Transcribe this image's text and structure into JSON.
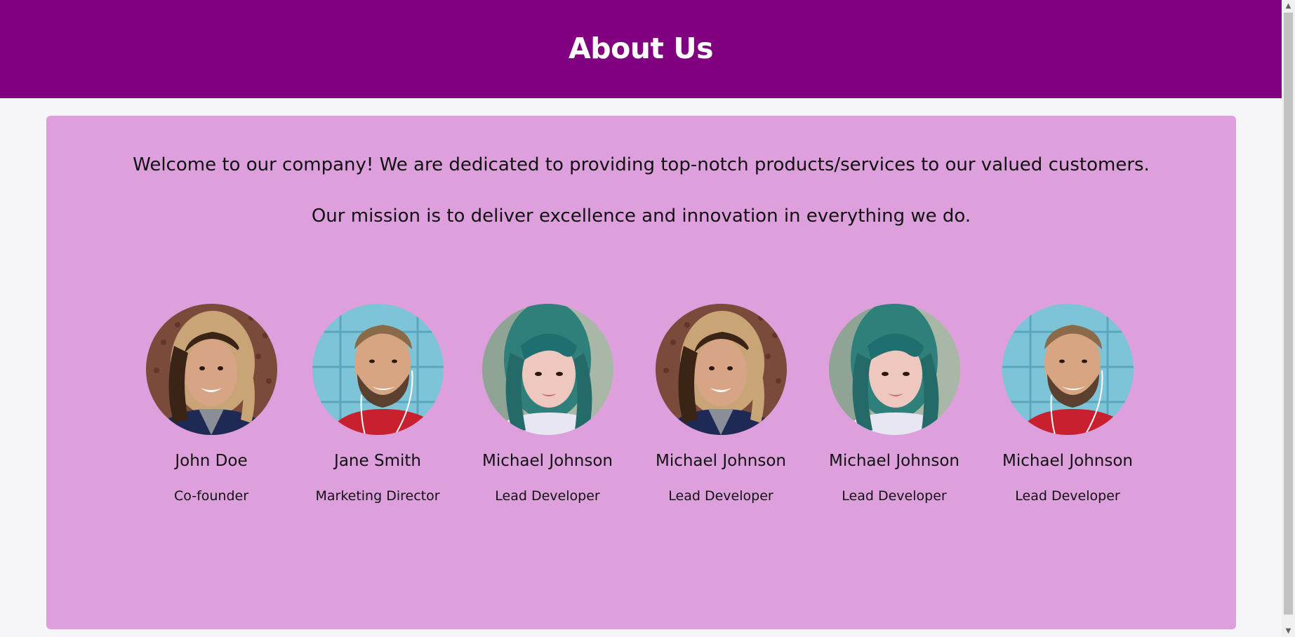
{
  "header": {
    "title": "About Us",
    "background": "#800080",
    "text_color": "#ffffff"
  },
  "card": {
    "background": "#dda0dd",
    "intro_line_1": "Welcome to our company! We are dedicated to providing top-notch products/services to our valued customers.",
    "intro_line_2": "Our mission is to deliver excellence and innovation in everything we do."
  },
  "team": [
    {
      "name": "John Doe",
      "role": "Co-founder",
      "photo": "woman-curly-hair-portrait"
    },
    {
      "name": "Jane Smith",
      "role": "Marketing Director",
      "photo": "bearded-man-portrait"
    },
    {
      "name": "Michael Johnson",
      "role": "Lead Developer",
      "photo": "teal-hair-woman-portrait"
    },
    {
      "name": "Michael Johnson",
      "role": "Lead Developer",
      "photo": "woman-curly-hair-portrait"
    },
    {
      "name": "Michael Johnson",
      "role": "Lead Developer",
      "photo": "teal-hair-woman-portrait"
    },
    {
      "name": "Michael Johnson",
      "role": "Lead Developer",
      "photo": "bearded-man-portrait"
    }
  ],
  "scrollbar": {
    "up_icon": "chevron-up-icon",
    "down_icon": "chevron-down-icon"
  }
}
